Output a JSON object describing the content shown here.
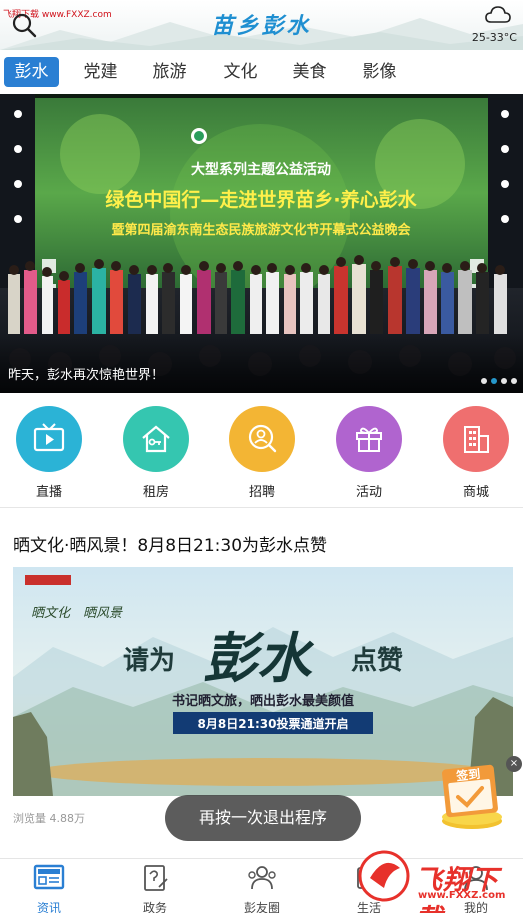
{
  "header": {
    "watermark": "飞翔下载 www.FXXZ.com",
    "title": "苗乡彭水",
    "weather_icon": "cloud-icon",
    "temperature": "25-33°C"
  },
  "tabs": [
    {
      "label": "彭水",
      "active": true
    },
    {
      "label": "党建"
    },
    {
      "label": "旅游"
    },
    {
      "label": "文化"
    },
    {
      "label": "美食"
    },
    {
      "label": "影像"
    }
  ],
  "banner": {
    "stage_line1": "大型系列主题公益活动",
    "stage_line2": "绿色中国行—走进世界苗乡·养心彭水",
    "stage_line3": "暨第四届渝东南生态民族旅游文化节开幕式公益晚会",
    "caption": "昨天，彭水再次惊艳世界！",
    "dot_count": 4,
    "active_dot": 2
  },
  "quick_links": [
    {
      "label": "直播",
      "icon": "tv-icon",
      "color": "#2bb3d6"
    },
    {
      "label": "租房",
      "icon": "house-key-icon",
      "color": "#35c6b0"
    },
    {
      "label": "招聘",
      "icon": "person-search-icon",
      "color": "#f3b534"
    },
    {
      "label": "活动",
      "icon": "gift-icon",
      "color": "#b064cf"
    },
    {
      "label": "商城",
      "icon": "building-icon",
      "color": "#ef6f6f"
    }
  ],
  "article": {
    "title": "晒文化·晒风景！8月8日21:30为彭水点赞",
    "img_small1": "晒文化",
    "img_small2": "晒风景",
    "img_main_a": "请为",
    "img_main_b": "彭水",
    "img_main_c": "点赞",
    "img_sub": "书记晒文旅，晒出彭水最美颜值",
    "img_banner": "8月8日21:30投票通道开启",
    "views": "浏览量 4.88万"
  },
  "toast": "再按一次退出程序",
  "sign_in": {
    "label": "签到",
    "close": "×"
  },
  "bottom_nav": [
    {
      "label": "资讯",
      "icon": "news-icon",
      "active": true
    },
    {
      "label": "政务",
      "icon": "document-edit-icon"
    },
    {
      "label": "彭友圈",
      "icon": "people-icon"
    },
    {
      "label": "生活",
      "icon": "life-icon"
    },
    {
      "label": "我的",
      "icon": "user-icon"
    }
  ],
  "watermark_br": {
    "text": "飞翔下载",
    "url": "www.FXXZ.com"
  }
}
